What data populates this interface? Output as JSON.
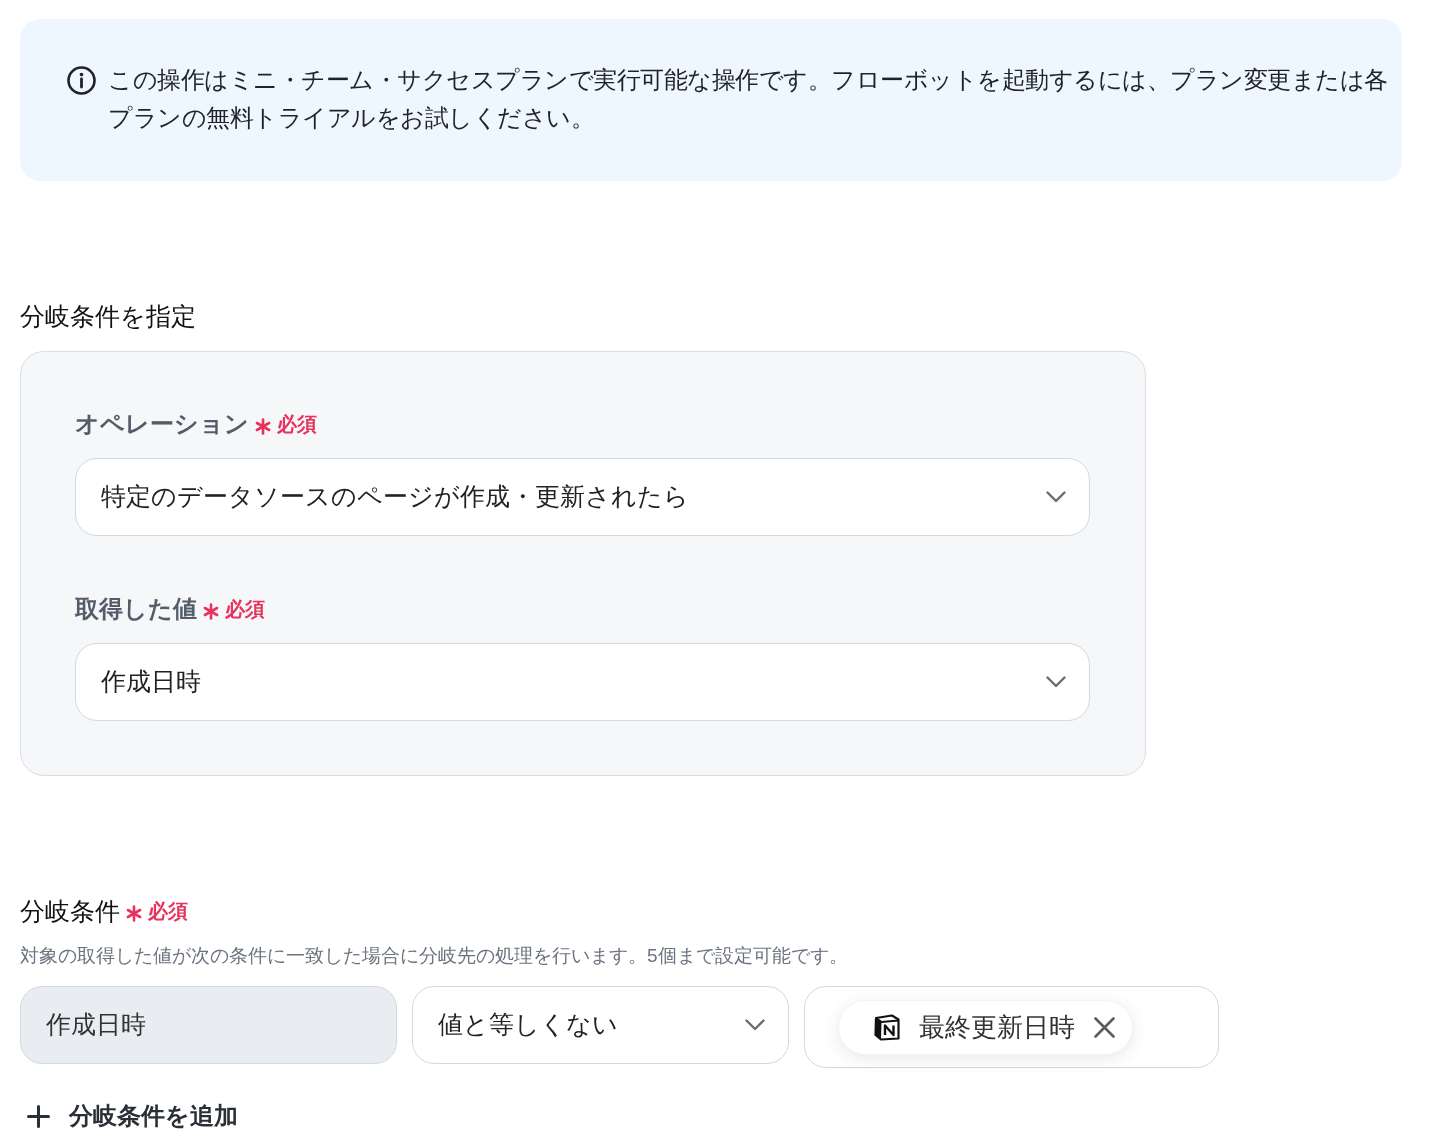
{
  "notice": {
    "text": "この操作はミニ・チーム・サクセスプランで実行可能な操作です。フローボットを起動するには、プラン変更または各プランの無料トライアルをお試しください。"
  },
  "branch_settings": {
    "title": "分岐条件を指定",
    "fields": [
      {
        "label": "オペレーション",
        "required": true,
        "required_label": "必須",
        "value": "特定のデータソースのページが作成・更新されたら"
      },
      {
        "label": "取得した値",
        "required": true,
        "required_label": "必須",
        "value": "作成日時"
      }
    ]
  },
  "conditions": {
    "title": "分岐条件",
    "required": true,
    "required_label": "必須",
    "description": "対象の取得した値が次の条件に一致した場合に分岐先の処理を行います。5個まで設定可能です。",
    "rows": [
      {
        "subject": {
          "value": "作成日時",
          "disabled": true
        },
        "operator": {
          "value": "値と等しくない"
        },
        "value": {
          "chips": [
            {
              "label": "最終更新日時"
            }
          ]
        }
      }
    ]
  },
  "add_condition_button": {
    "label": "分岐条件を追加"
  }
}
